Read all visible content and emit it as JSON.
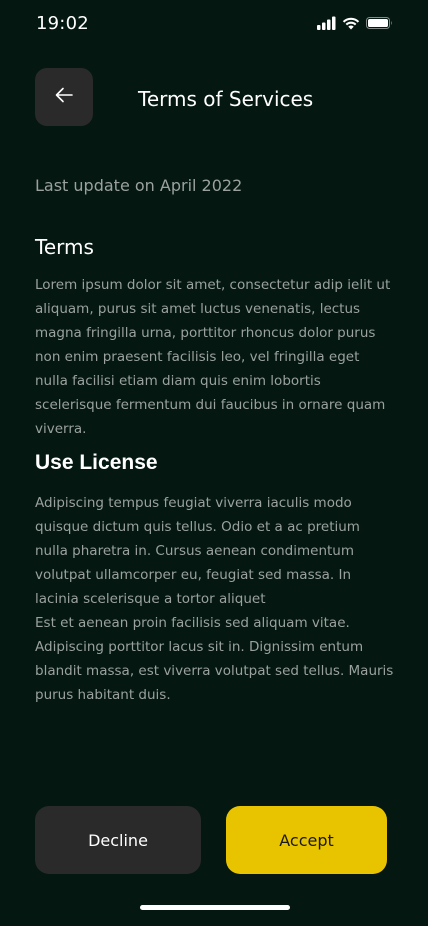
{
  "status_bar": {
    "time": "19:02",
    "icons": [
      "signal-icon",
      "wifi-icon",
      "battery-icon"
    ]
  },
  "header": {
    "back_icon": "arrow-left-icon",
    "title": "Terms of Services"
  },
  "last_update": "Last update on April 2022",
  "sections": [
    {
      "title": "Terms",
      "body": "Lorem ipsum dolor sit amet, consectetur adip ielit ut aliquam, purus sit amet luctus venenatis, lectus magna fringilla urna, porttitor rhoncus dolor purus non enim praesent  facilisis leo, vel fringilla  eget nulla facilisi etiam diam quis enim lobortis scelerisque fermentum dui faucibus in ornare quam viverra."
    },
    {
      "title": "Use License",
      "body": "Adipiscing tempus feugiat viverra iaculis modo quisque dictum quis tellus. Odio et a ac pretium nulla pharetra in. Cursus aenean condimentum volutpat ullamcorper eu, feugiat sed massa. In lacinia scelerisque a tortor aliquet\nEst et aenean proin facilisis sed aliquam vitae. Adipiscing porttitor lacus sit in. Dignissim entum blandit massa, est viverra volutpat sed tellus. Mauris purus habitant duis."
    }
  ],
  "actions": {
    "decline_label": "Decline",
    "accept_label": "Accept"
  },
  "colors": {
    "background": "#041710",
    "accent": "#e8c400",
    "secondary_button": "#2a2a2a",
    "muted_text": "#9aa19e"
  }
}
